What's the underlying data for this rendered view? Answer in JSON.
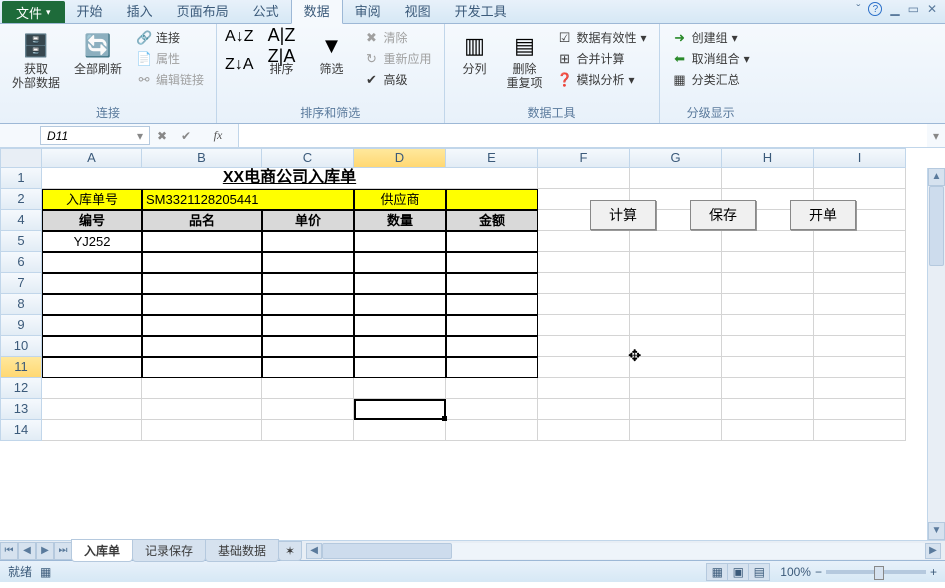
{
  "window": {
    "help_icon": "?",
    "min_icon": "▁",
    "caret_icon": "ˇ",
    "restore_icon": "▭",
    "close_icon": "✕"
  },
  "tabs": {
    "file": "文件",
    "items": [
      "开始",
      "插入",
      "页面布局",
      "公式",
      "数据",
      "审阅",
      "视图",
      "开发工具"
    ],
    "active_index": 4
  },
  "ribbon": {
    "group_connections": {
      "get_external": "获取\n外部数据",
      "refresh_all": "全部刷新",
      "connections": "连接",
      "properties": "属性",
      "edit_links": "编辑链接",
      "label": "连接"
    },
    "group_sort": {
      "sort": "排序",
      "filter": "筛选",
      "clear": "清除",
      "reapply": "重新应用",
      "advanced": "高级",
      "label": "排序和筛选"
    },
    "group_tools": {
      "text_to_cols": "分列",
      "remove_dup": "删除\n重复项",
      "validation": "数据有效性",
      "consolidate": "合并计算",
      "whatif": "模拟分析",
      "label": "数据工具"
    },
    "group_outline": {
      "group": "创建组",
      "ungroup": "取消组合",
      "subtotal": "分类汇总",
      "label": "分级显示"
    }
  },
  "namebox": "D11",
  "fx": "fx",
  "columns": [
    "A",
    "B",
    "C",
    "D",
    "E",
    "F",
    "G",
    "H",
    "I"
  ],
  "rows_visible": 14,
  "active": {
    "row": 11,
    "col": "D"
  },
  "sheet": {
    "title": "XX电商公司入库单",
    "r2": {
      "a": "入库单号",
      "b": "SM3321128205441",
      "d": "供应商"
    },
    "headers": [
      "编号",
      "品名",
      "单价",
      "数量",
      "金额"
    ],
    "r5a": "YJ252",
    "buttons": {
      "calc": "计算",
      "save": "保存",
      "open": "开单"
    }
  },
  "sheettabs": {
    "items": [
      "入库单",
      "记录保存",
      "基础数据"
    ],
    "active_index": 0
  },
  "status": {
    "ready": "就绪",
    "macro_icon": "▦",
    "zoom": "100%",
    "minus": "−",
    "plus": "+"
  }
}
